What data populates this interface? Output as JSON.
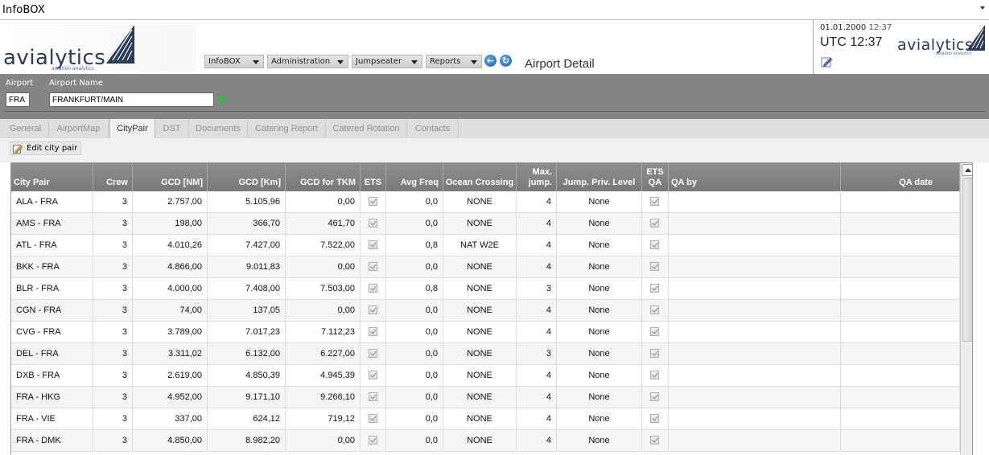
{
  "window": {
    "title": "InfoBOX"
  },
  "logo": {
    "word": "avialytics",
    "tagline": "aviation analytics"
  },
  "nav": {
    "menus": [
      {
        "label": "InfoBOX"
      },
      {
        "label": "Administration"
      },
      {
        "label": "Jumpseater"
      },
      {
        "label": "Reports"
      }
    ],
    "back_icon": "back-arrow-icon",
    "refresh_icon": "refresh-icon"
  },
  "page_title": "Airport Detail",
  "clock": {
    "date": "01.01.2000",
    "time": "12:37",
    "utc": "UTC 12:37"
  },
  "airport": {
    "code_label": "Airport",
    "code_value": "FRA",
    "name_label": "Airport Name",
    "name_value": "FRANKFURT/MAIN"
  },
  "tabs": [
    {
      "label": "General",
      "active": false
    },
    {
      "label": "AirportMap",
      "active": false
    },
    {
      "label": "CityPair",
      "active": true
    },
    {
      "label": "DST",
      "active": false
    },
    {
      "label": "Documents",
      "active": false
    },
    {
      "label": "Catering Report",
      "active": false
    },
    {
      "label": "Catered Rotation",
      "active": false
    },
    {
      "label": "Contacts",
      "active": false
    }
  ],
  "toolbar": {
    "edit_label": "Edit city pair"
  },
  "grid": {
    "columns": [
      {
        "key": "pair",
        "label": "City Pair"
      },
      {
        "key": "crew",
        "label": "Crew"
      },
      {
        "key": "gcd_nm",
        "label": "GCD [NM]"
      },
      {
        "key": "gcd_km",
        "label": "GCD [Km]"
      },
      {
        "key": "gcd_tkm",
        "label": "GCD for TKM"
      },
      {
        "key": "ets",
        "label": "ETS"
      },
      {
        "key": "avg_freq",
        "label": "Avg Freq"
      },
      {
        "key": "ocean",
        "label": "Ocean Crossing"
      },
      {
        "key": "max_jump",
        "label": "Max. jump."
      },
      {
        "key": "priv",
        "label": "Jump. Priv. Level"
      },
      {
        "key": "ets_qa",
        "label": "ETS QA"
      },
      {
        "key": "qa_by",
        "label": "QA by"
      },
      {
        "key": "qa_date",
        "label": "QA date"
      }
    ],
    "rows": [
      {
        "pair": "ALA - FRA",
        "crew": "3",
        "gcd_nm": "2.757,00",
        "gcd_km": "5.105,96",
        "gcd_tkm": "0,00",
        "avg_freq": "0,0",
        "ocean": "NONE",
        "max_jump": "4",
        "priv": "None",
        "qa_by": "",
        "qa_date": ""
      },
      {
        "pair": "AMS - FRA",
        "crew": "3",
        "gcd_nm": "198,00",
        "gcd_km": "366,70",
        "gcd_tkm": "461,70",
        "avg_freq": "0,0",
        "ocean": "NONE",
        "max_jump": "4",
        "priv": "None",
        "qa_by": "",
        "qa_date": ""
      },
      {
        "pair": "ATL - FRA",
        "crew": "3",
        "gcd_nm": "4.010,26",
        "gcd_km": "7.427,00",
        "gcd_tkm": "7.522,00",
        "avg_freq": "0,8",
        "ocean": "NAT W2E",
        "max_jump": "4",
        "priv": "None",
        "qa_by": "",
        "qa_date": ""
      },
      {
        "pair": "BKK - FRA",
        "crew": "3",
        "gcd_nm": "4.866,00",
        "gcd_km": "9.011,83",
        "gcd_tkm": "0,00",
        "avg_freq": "0,0",
        "ocean": "NONE",
        "max_jump": "4",
        "priv": "None",
        "qa_by": "",
        "qa_date": ""
      },
      {
        "pair": "BLR - FRA",
        "crew": "3",
        "gcd_nm": "4.000,00",
        "gcd_km": "7.408,00",
        "gcd_tkm": "7.503,00",
        "avg_freq": "0,8",
        "ocean": "NONE",
        "max_jump": "3",
        "priv": "None",
        "qa_by": "",
        "qa_date": ""
      },
      {
        "pair": "CGN - FRA",
        "crew": "3",
        "gcd_nm": "74,00",
        "gcd_km": "137,05",
        "gcd_tkm": "0,00",
        "avg_freq": "0,0",
        "ocean": "NONE",
        "max_jump": "4",
        "priv": "None",
        "qa_by": "",
        "qa_date": ""
      },
      {
        "pair": "CVG - FRA",
        "crew": "3",
        "gcd_nm": "3.789,00",
        "gcd_km": "7.017,23",
        "gcd_tkm": "7.112,23",
        "avg_freq": "0,0",
        "ocean": "NONE",
        "max_jump": "4",
        "priv": "None",
        "qa_by": "",
        "qa_date": ""
      },
      {
        "pair": "DEL - FRA",
        "crew": "3",
        "gcd_nm": "3.311,02",
        "gcd_km": "6.132,00",
        "gcd_tkm": "6.227,00",
        "avg_freq": "0,0",
        "ocean": "NONE",
        "max_jump": "3",
        "priv": "None",
        "qa_by": "",
        "qa_date": ""
      },
      {
        "pair": "DXB - FRA",
        "crew": "3",
        "gcd_nm": "2.619,00",
        "gcd_km": "4.850,39",
        "gcd_tkm": "4.945,39",
        "avg_freq": "0,0",
        "ocean": "NONE",
        "max_jump": "4",
        "priv": "None",
        "qa_by": "",
        "qa_date": ""
      },
      {
        "pair": "FRA - HKG",
        "crew": "3",
        "gcd_nm": "4.952,00",
        "gcd_km": "9.171,10",
        "gcd_tkm": "9.266,10",
        "avg_freq": "0,0",
        "ocean": "NONE",
        "max_jump": "4",
        "priv": "None",
        "qa_by": "",
        "qa_date": ""
      },
      {
        "pair": "FRA - VIE",
        "crew": "3",
        "gcd_nm": "337,00",
        "gcd_km": "624,12",
        "gcd_tkm": "719,12",
        "avg_freq": "0,0",
        "ocean": "NONE",
        "max_jump": "4",
        "priv": "None",
        "qa_by": "",
        "qa_date": ""
      },
      {
        "pair": "FRA - DMK",
        "crew": "3",
        "gcd_nm": "4.850,00",
        "gcd_km": "8.982,20",
        "gcd_tkm": "0,00",
        "avg_freq": "0,0",
        "ocean": "NONE",
        "max_jump": "4",
        "priv": "None",
        "qa_by": "",
        "qa_date": ""
      }
    ]
  }
}
